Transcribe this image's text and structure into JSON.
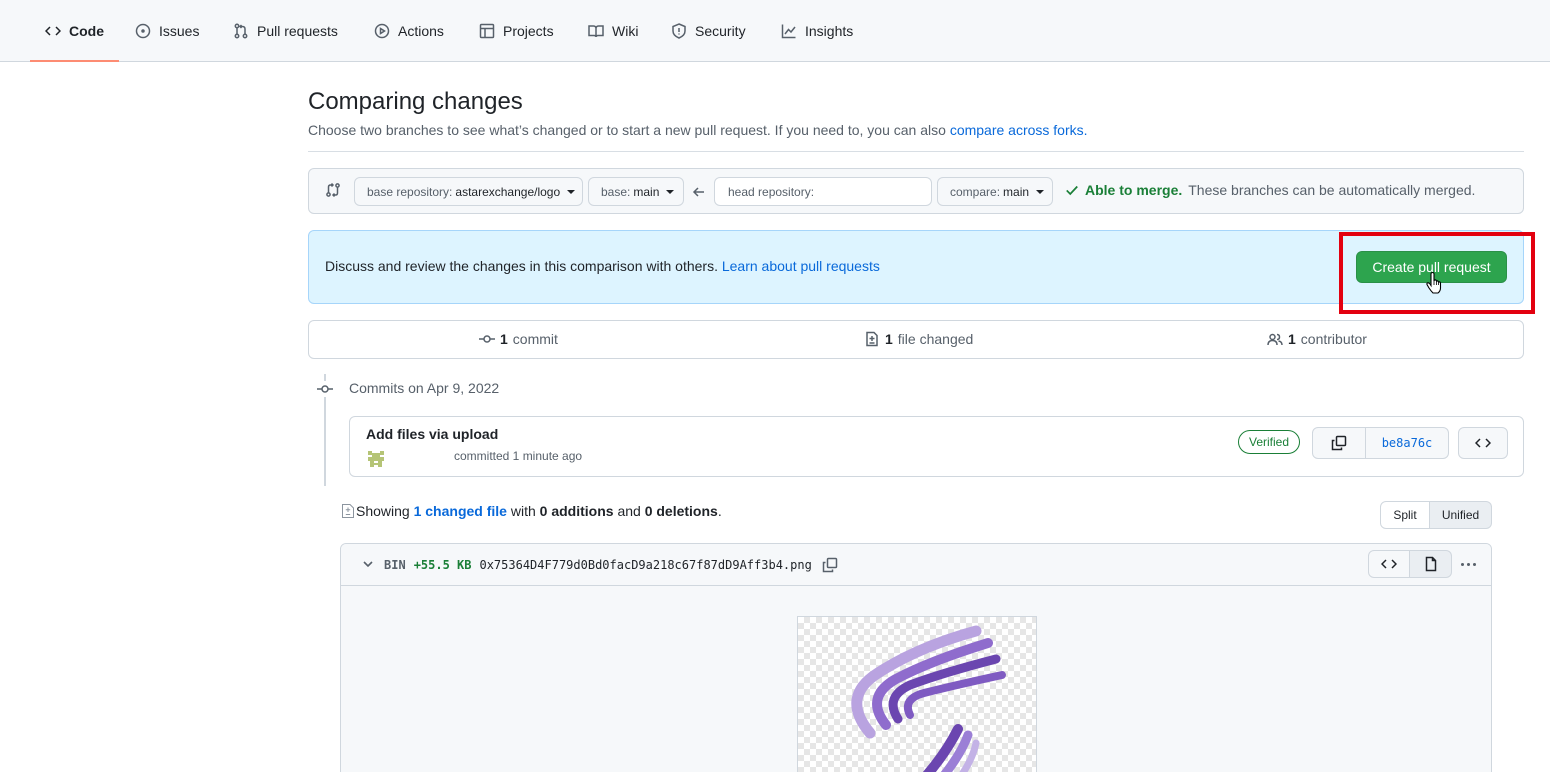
{
  "nav": {
    "tabs": [
      {
        "label": "Code",
        "icon": "code-icon",
        "selected": true
      },
      {
        "label": "Issues",
        "icon": "issue-icon"
      },
      {
        "label": "Pull requests",
        "icon": "pull-request-icon"
      },
      {
        "label": "Actions",
        "icon": "play-icon"
      },
      {
        "label": "Projects",
        "icon": "table-icon"
      },
      {
        "label": "Wiki",
        "icon": "book-icon"
      },
      {
        "label": "Security",
        "icon": "shield-icon"
      },
      {
        "label": "Insights",
        "icon": "graph-icon"
      }
    ]
  },
  "header": {
    "title": "Comparing changes",
    "subtitle": "Choose two branches to see what’s changed or to start a new pull request. If you need to, you can also",
    "subtitle_link": "compare across forks."
  },
  "range": {
    "base_repo_label": "base repository:",
    "base_repo_value": "astarexchange/logo",
    "base_label": "base:",
    "base_value": "main",
    "head_repo_placeholder": "head repository:",
    "compare_label": "compare:",
    "compare_value": "main",
    "merge_ok": "Able to merge.",
    "merge_text": "These branches can be automatically merged."
  },
  "flash": {
    "text": "Discuss and review the changes in this comparison with others.",
    "link": "Learn about pull requests",
    "button": "Create pull request"
  },
  "summary": {
    "commits_num": "1",
    "commits_label": "commit",
    "files_num": "1",
    "files_label": "file changed",
    "contributors_num": "1",
    "contributors_label": "contributor"
  },
  "commits": {
    "heading": "Commits on Apr 9, 2022",
    "items": [
      {
        "title": "Add files via upload",
        "meta": "committed 1 minute ago",
        "badge": "Verified",
        "sha": "be8a76c"
      }
    ]
  },
  "diff": {
    "showing": "Showing",
    "changed_link": "1 changed file",
    "with": "with",
    "additions": "0 additions",
    "and": "and",
    "deletions": "0 deletions",
    "period": ".",
    "split": "Split",
    "unified": "Unified"
  },
  "file": {
    "type": "BIN",
    "size": "+55.5 KB",
    "name": "0x75364D4F779d0Bd0facD9a218c67f87dD9Aff3b4.png"
  },
  "colors": {
    "accent_tab": "#fd8c73",
    "primary_button": "#2da44e",
    "link": "#0969da",
    "success": "#1a7f37",
    "flash_bg": "#ddf4ff",
    "highlight": "#e3000f",
    "logo_purple": "#6b46b0"
  }
}
